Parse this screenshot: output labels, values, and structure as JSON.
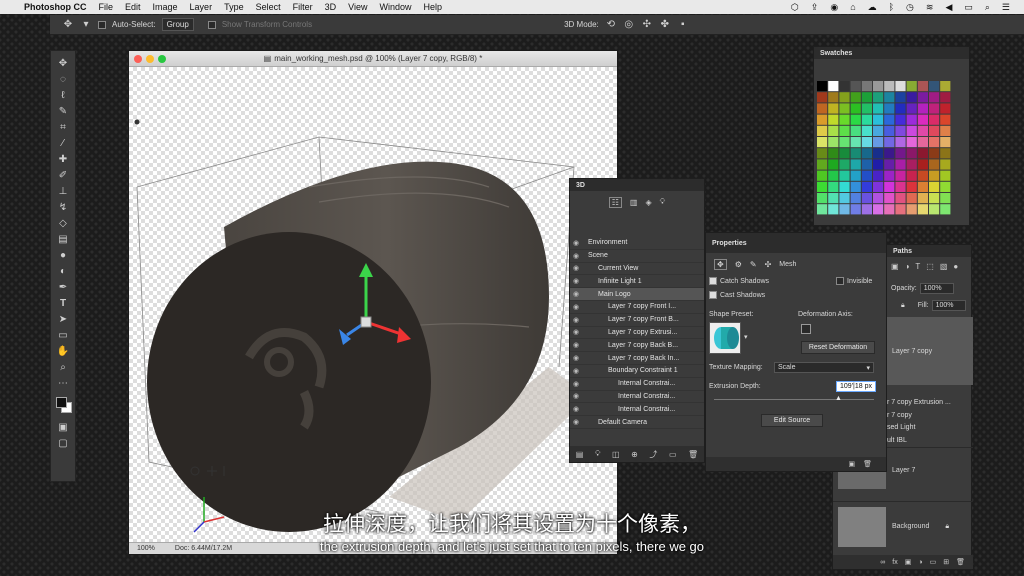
{
  "menubar": {
    "app": "Photoshop CC",
    "items": [
      "File",
      "Edit",
      "Image",
      "Layer",
      "Type",
      "Select",
      "Filter",
      "3D",
      "View",
      "Window",
      "Help"
    ]
  },
  "options": {
    "auto_select_label": "Auto-Select:",
    "auto_select_value": "Group",
    "show_transform": "Show Transform Controls",
    "mode_label": "3D Mode:"
  },
  "document": {
    "title": "main_working_mesh.psd @ 100% (Layer 7 copy, RGB/8) *",
    "zoom": "100%",
    "doc_size": "Doc: 6.44M/17.2M"
  },
  "swatches": {
    "title": "Swatches"
  },
  "panel3d": {
    "title": "3D",
    "items": [
      {
        "label": "Environment",
        "indent": 0
      },
      {
        "label": "Scene",
        "indent": 0
      },
      {
        "label": "Current View",
        "indent": 1
      },
      {
        "label": "Infinite Light 1",
        "indent": 1
      },
      {
        "label": "Main Logo",
        "indent": 1
      },
      {
        "label": "Layer 7 copy Front I...",
        "indent": 2
      },
      {
        "label": "Layer 7 copy Front B...",
        "indent": 2
      },
      {
        "label": "Layer 7 copy Extrusi...",
        "indent": 2
      },
      {
        "label": "Layer 7 copy Back B...",
        "indent": 2
      },
      {
        "label": "Layer 7 copy Back In...",
        "indent": 2
      },
      {
        "label": "Boundary Constraint 1",
        "indent": 2
      },
      {
        "label": "Internal Constrai...",
        "indent": 3
      },
      {
        "label": "Internal Constrai...",
        "indent": 3
      },
      {
        "label": "Internal Constrai...",
        "indent": 3
      },
      {
        "label": "Default Camera",
        "indent": 1
      }
    ]
  },
  "properties": {
    "title": "Properties",
    "tab_mesh": "Mesh",
    "catch_shadows": "Catch Shadows",
    "cast_shadows": "Cast Shadows",
    "invisible": "Invisible",
    "shape_preset": "Shape Preset:",
    "deformation_axis": "Deformation Axis:",
    "reset_deformation": "Reset Deformation",
    "texture_mapping_label": "Texture Mapping:",
    "texture_mapping_value": "Scale",
    "extrusion_depth_label": "Extrusion Depth:",
    "extrusion_depth_value": "109'|18 px",
    "edit_source": "Edit Source"
  },
  "layers": {
    "tab_paths": "Paths",
    "opacity_label": "Opacity:",
    "opacity_value": "100%",
    "fill_label": "Fill:",
    "fill_value": "100%",
    "layer_7_copy": "Layer 7 copy",
    "sub_items": [
      "r 7 copy Extrusion ...",
      "r 7 copy",
      "sed Light",
      "ult IBL"
    ],
    "layer_7": "Layer 7",
    "background": "Background"
  },
  "subtitles": {
    "cn": "拉伸深度，让我们将其设置为十个像素，",
    "en": "the extrusion depth, and let's just set that to ten pixels, there we go"
  }
}
